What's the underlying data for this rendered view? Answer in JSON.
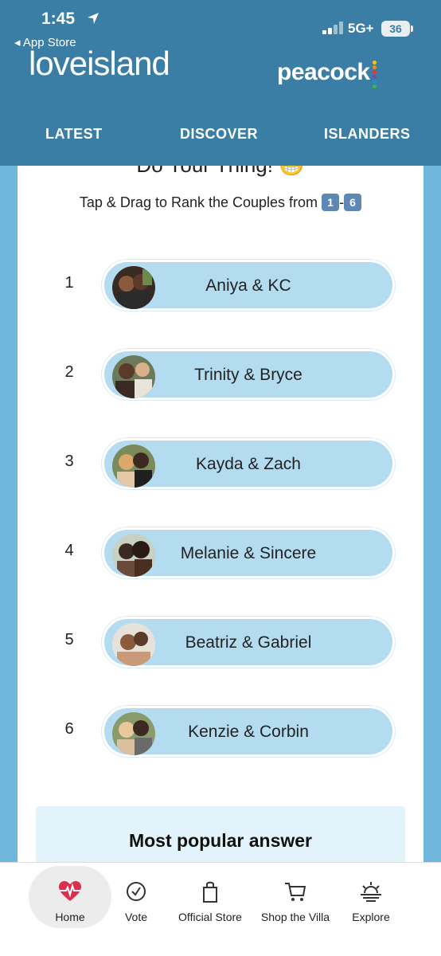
{
  "status_bar": {
    "time": "1:45",
    "back_label": "◂ App Store",
    "network": "5G+",
    "battery": "36"
  },
  "brand": {
    "love_island_light": "love",
    "love_island_bold": "",
    "love_island_rest": "island",
    "peacock": "peacock"
  },
  "nav": {
    "tabs": [
      {
        "label": "LATEST"
      },
      {
        "label": "DISCOVER"
      },
      {
        "label": "ISLANDERS"
      }
    ]
  },
  "poll": {
    "title": "Do Your Thing! 😁",
    "subtitle_prefix": "Tap & Drag to Rank the Couples from",
    "rank_from": "1",
    "rank_dash": "-",
    "rank_to": "6",
    "couples": [
      {
        "rank": "1",
        "name": "Aniya & KC"
      },
      {
        "rank": "2",
        "name": "Trinity & Bryce"
      },
      {
        "rank": "3",
        "name": "Kayda & Zach"
      },
      {
        "rank": "4",
        "name": "Melanie & Sincere"
      },
      {
        "rank": "5",
        "name": "Beatriz & Gabriel"
      },
      {
        "rank": "6",
        "name": "Kenzie & Corbin"
      }
    ],
    "most_popular_label": "Most popular answer"
  },
  "tabbar": {
    "items": [
      {
        "label": "Home",
        "icon": "heartbeat-icon"
      },
      {
        "label": "Vote",
        "icon": "check-circle-icon"
      },
      {
        "label": "Official Store",
        "icon": "shopping-bag-icon"
      },
      {
        "label": "Shop the Villa",
        "icon": "shopping-cart-icon"
      },
      {
        "label": "Explore",
        "icon": "sunset-icon"
      }
    ]
  },
  "colors": {
    "header": "#3b7ea5",
    "pill": "#b3dcf1",
    "side": "#6fb6dc",
    "home_accent": "#d9304f"
  }
}
